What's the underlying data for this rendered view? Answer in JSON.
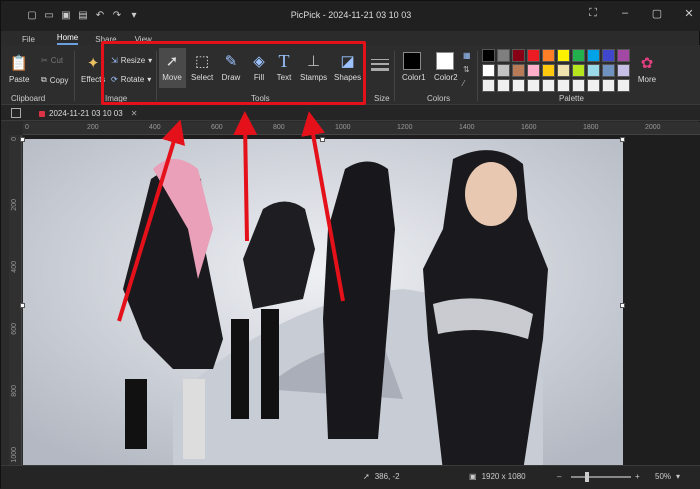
{
  "app": {
    "title": "PicPick - 2024-11-21 03 10 03"
  },
  "quick_access": {
    "icons": [
      "new-file-icon",
      "open-folder-icon",
      "save-icon",
      "print-icon",
      "undo-icon",
      "redo-icon",
      "customize-icon"
    ]
  },
  "menu": {
    "file": "File",
    "home": "Home",
    "share": "Share",
    "view": "View"
  },
  "ribbon": {
    "clipboard": {
      "paste": "Paste",
      "cut": "Cut",
      "copy": "Copy",
      "label": "Clipboard"
    },
    "image": {
      "effects": "Effects",
      "resize": "Resize",
      "rotate": "Rotate",
      "label": "Image"
    },
    "tools": {
      "move": "Move",
      "select": "Select",
      "draw": "Draw",
      "fill": "Fill",
      "text": "Text",
      "stamps": "Stamps",
      "shapes": "Shapes",
      "label": "Tools"
    },
    "size": {
      "label": "Size"
    },
    "colors": {
      "color1": "Color1",
      "color2": "Color2",
      "label": "Colors",
      "color1_value": "#000000",
      "color2_value": "#ffffff"
    },
    "palette": {
      "label": "Palette",
      "more": "More",
      "colors": [
        "#000000",
        "#7f7f7f",
        "#880015",
        "#ed1c24",
        "#ff7f27",
        "#fff200",
        "#22b14c",
        "#00a2e8",
        "#3f48cc",
        "#a349a4",
        "#ffffff",
        "#c3c3c3",
        "#b97a57",
        "#ffaec9",
        "#ffc90e",
        "#efe4b0",
        "#b5e61d",
        "#99d9ea",
        "#7092be",
        "#c8bfe7",
        "#f0f0f0",
        "#f0f0f0",
        "#f0f0f0",
        "#f0f0f0",
        "#f0f0f0",
        "#f0f0f0",
        "#f0f0f0",
        "#f0f0f0",
        "#f0f0f0",
        "#f0f0f0"
      ]
    }
  },
  "tab": {
    "name": "2024-11-21 03 10 03"
  },
  "ruler": {
    "h": [
      "0",
      "200",
      "400",
      "600",
      "800",
      "1000",
      "1200",
      "1400",
      "1600",
      "1800",
      "2000"
    ],
    "v": [
      "0",
      "200",
      "400",
      "600",
      "800",
      "1000"
    ]
  },
  "status": {
    "cursor": "386, -2",
    "dimensions": "1920 x 1080",
    "zoom": "50%"
  },
  "accent": "#e4101a"
}
